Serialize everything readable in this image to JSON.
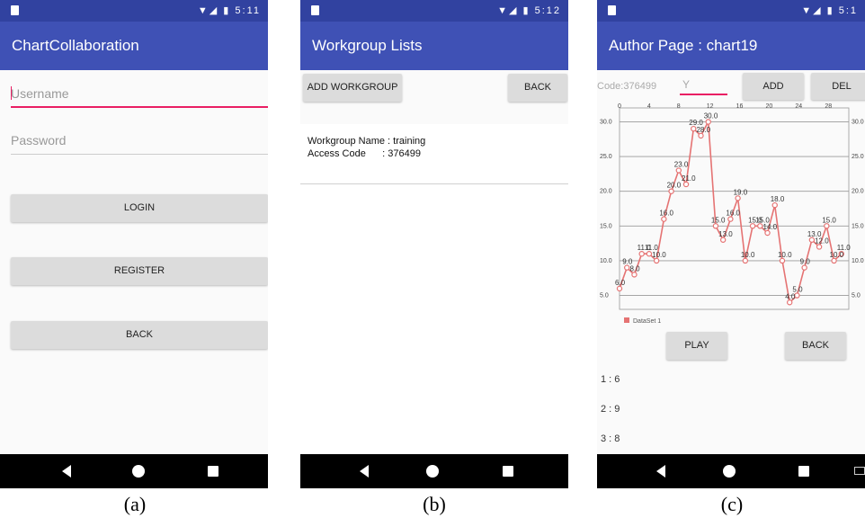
{
  "screen_a": {
    "status_time": "5:11",
    "app_title": "ChartCollaboration",
    "username_placeholder": "Username",
    "password_placeholder": "Password",
    "login_label": "LOGIN",
    "register_label": "REGISTER",
    "back_label": "BACK",
    "caption": "(a)"
  },
  "screen_b": {
    "status_time": "5:12",
    "title": "Workgroup Lists",
    "add_label": "ADD WORKGROUP",
    "back_label": "BACK",
    "items": [
      {
        "name_line": "Workgroup Name : training",
        "code_line": "Access Code      : 376499"
      }
    ],
    "caption": "(b)"
  },
  "screen_c": {
    "status_time": "5:1",
    "title": "Author Page : chart19",
    "code_label": "Code:376499",
    "y_placeholder": "Y",
    "add_label": "ADD",
    "del_label": "DEL",
    "play_label": "PLAY",
    "back_label": "BACK",
    "list": [
      "1 : 6",
      "2 : 9",
      "3 : 8"
    ],
    "caption": "(c)"
  },
  "chart_data": {
    "type": "line",
    "x_ticks": [
      "0",
      "4",
      "8",
      "12",
      "16",
      "20",
      "24",
      "28"
    ],
    "y_ticks": [
      "5.0",
      "10.0",
      "15.0",
      "20.0",
      "25.0",
      "30.0"
    ],
    "ylim": [
      3,
      32
    ],
    "xlim": [
      0,
      31
    ],
    "series": [
      {
        "name": "DataSet 1",
        "color": "#e57373",
        "x": [
          0,
          1,
          2,
          3,
          4,
          5,
          6,
          7,
          8,
          9,
          10,
          11,
          12,
          13,
          14,
          15,
          16,
          17,
          18,
          19,
          20,
          21,
          22,
          23,
          24,
          25,
          26,
          27,
          28,
          29,
          30
        ],
        "y": [
          6,
          9,
          8,
          11,
          11,
          10,
          16,
          20,
          23,
          21,
          29,
          28,
          30,
          15,
          13,
          16,
          19,
          10,
          15,
          15,
          14,
          18,
          10,
          4,
          5,
          9,
          13,
          12,
          15,
          10,
          11
        ]
      }
    ]
  }
}
